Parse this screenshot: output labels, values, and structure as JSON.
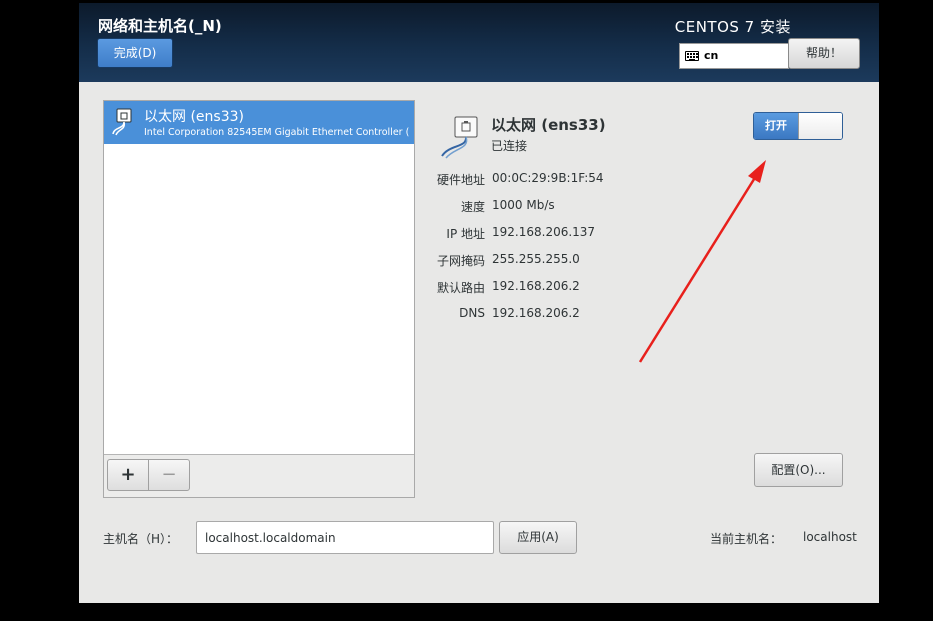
{
  "header": {
    "title": "网络和主机名(_N)",
    "done_label": "完成(D)",
    "product": "CENTOS 7 安装",
    "keyboard_layout": "cn",
    "help_label": "帮助！"
  },
  "device_list": {
    "items": [
      {
        "name": "以太网 (ens33)",
        "description": "Intel Corporation 82545EM Gigabit Ethernet Controller (",
        "icon": "ethernet-icon",
        "selected": true
      }
    ],
    "add_label": "+",
    "remove_label": "−"
  },
  "detail": {
    "icon": "ethernet-icon",
    "title": "以太网 (ens33)",
    "status": "已连接",
    "info": [
      {
        "label": "硬件地址",
        "value": "00:0C:29:9B:1F:54"
      },
      {
        "label": "速度",
        "value": "1000 Mb/s"
      },
      {
        "label": "IP 地址",
        "value": "192.168.206.137"
      },
      {
        "label": "子网掩码",
        "value": "255.255.255.0"
      },
      {
        "label": "默认路由",
        "value": "192.168.206.2"
      },
      {
        "label": "DNS",
        "value": "192.168.206.2"
      }
    ],
    "toggle_label": "打开",
    "toggle_on": true,
    "config_label": "配置(O)..."
  },
  "hostname": {
    "label": "主机名（H）：",
    "value": "localhost.localdomain",
    "apply_label": "应用(A)",
    "current_label": "当前主机名：",
    "current_value": "localhost"
  },
  "colors": {
    "accent": "#4a90d9",
    "header_bg": "#142d49",
    "annotation_arrow": "#e8201c"
  }
}
